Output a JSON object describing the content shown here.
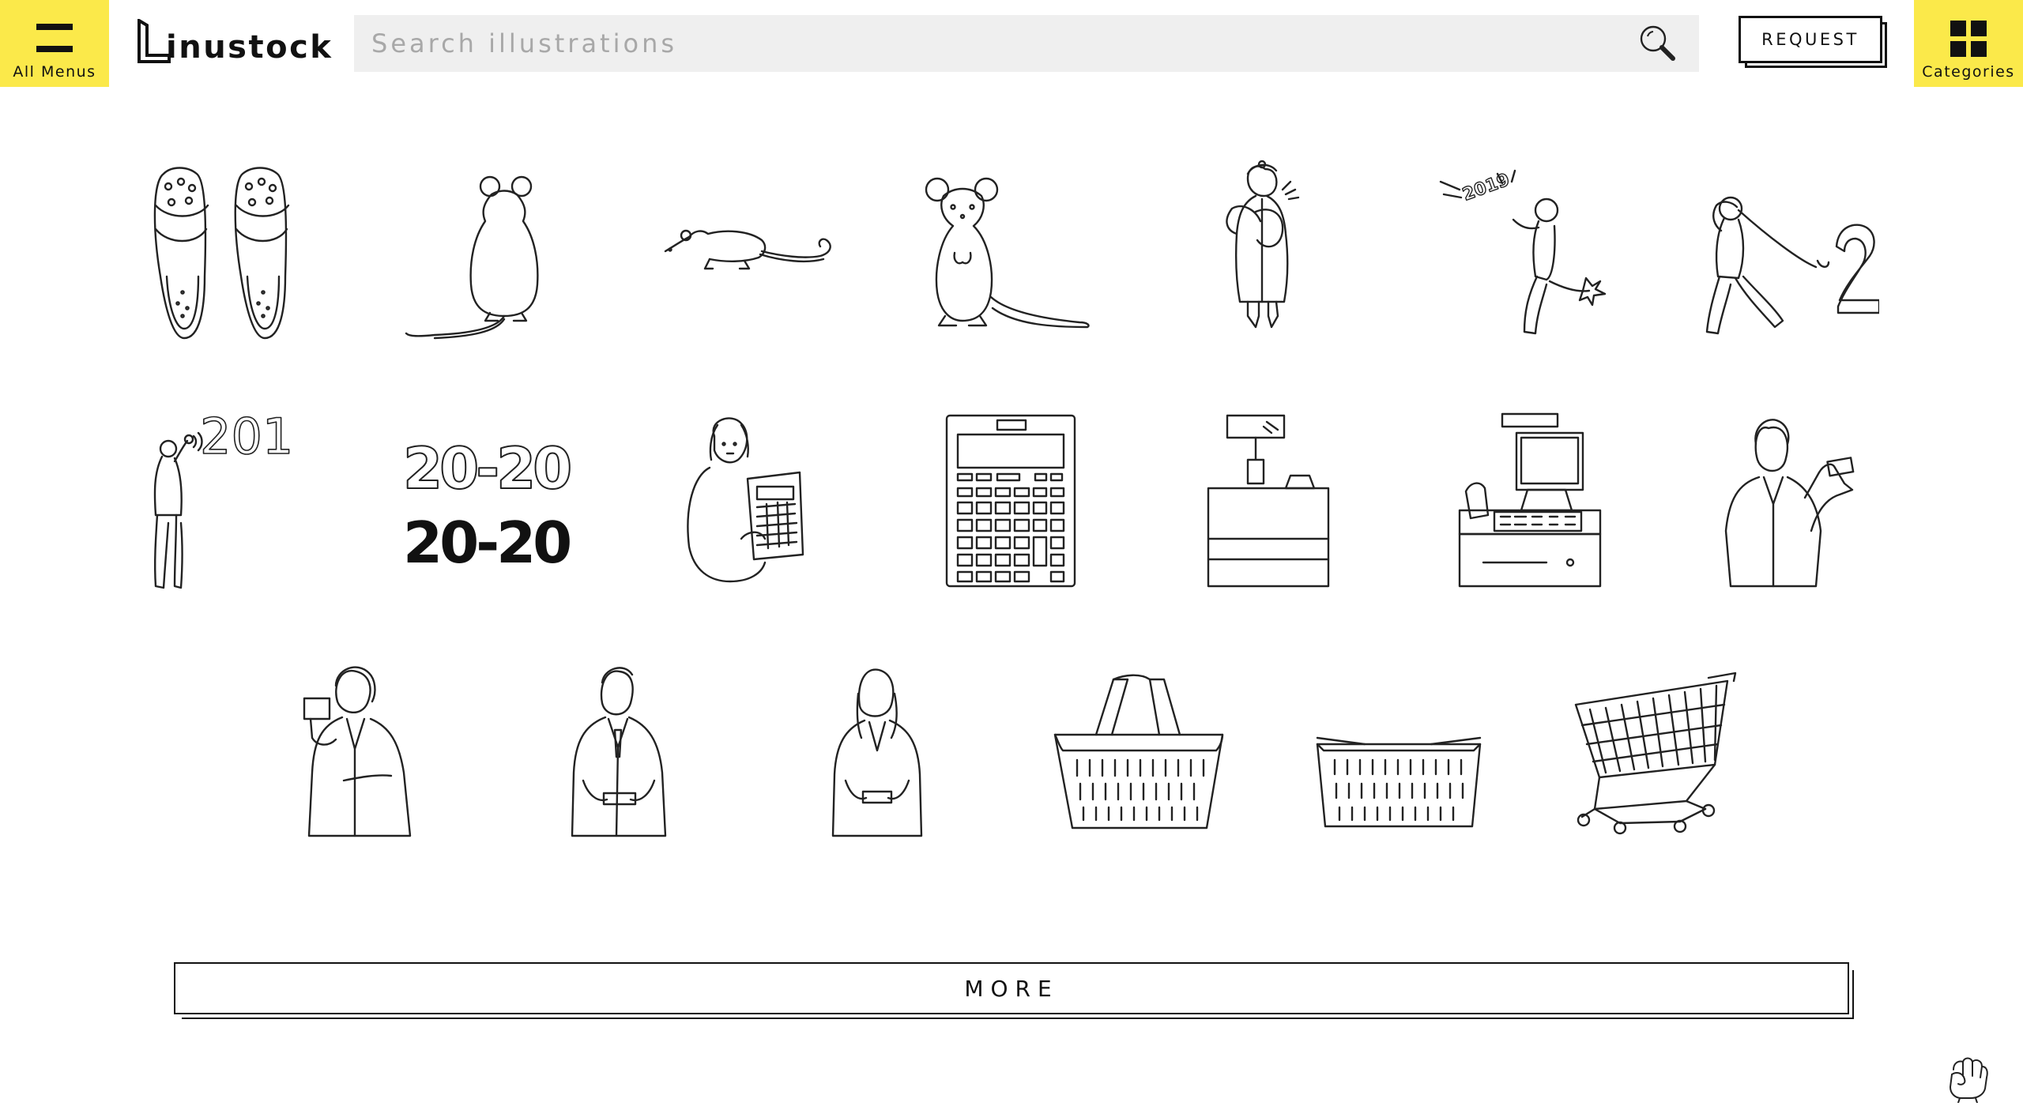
{
  "header": {
    "menu_label": "All Menus",
    "logo_text": "inustock",
    "search_placeholder": "Search illustrations",
    "request_label": "REQUEST",
    "categories_label": "Categories",
    "accent_color": "#fbe94a"
  },
  "grid": {
    "illustrations": [
      {
        "name": "sandals"
      },
      {
        "name": "mouse-back"
      },
      {
        "name": "mouse-walking"
      },
      {
        "name": "mouse-front"
      },
      {
        "name": "woman-winter-coat"
      },
      {
        "name": "man-kicking-2019"
      },
      {
        "name": "man-pulling-2"
      },
      {
        "name": "woman-waving-2019"
      },
      {
        "name": "2020-numbers"
      },
      {
        "name": "woman-calculator"
      },
      {
        "name": "calculator"
      },
      {
        "name": "cash-register"
      },
      {
        "name": "pos-register"
      },
      {
        "name": "man-business-card"
      },
      {
        "name": "woman-card"
      },
      {
        "name": "man-bowing-card"
      },
      {
        "name": "woman-bowing-card"
      },
      {
        "name": "shopping-basket-handles"
      },
      {
        "name": "shopping-basket"
      },
      {
        "name": "shopping-cart"
      }
    ],
    "number_2020_outline": "20-20",
    "number_2020_solid": "20-20",
    "number_2019": "2019",
    "number_201": "201",
    "number_2": "2"
  },
  "more_label": "MORE",
  "footer": {
    "icon": "fist-icon"
  }
}
